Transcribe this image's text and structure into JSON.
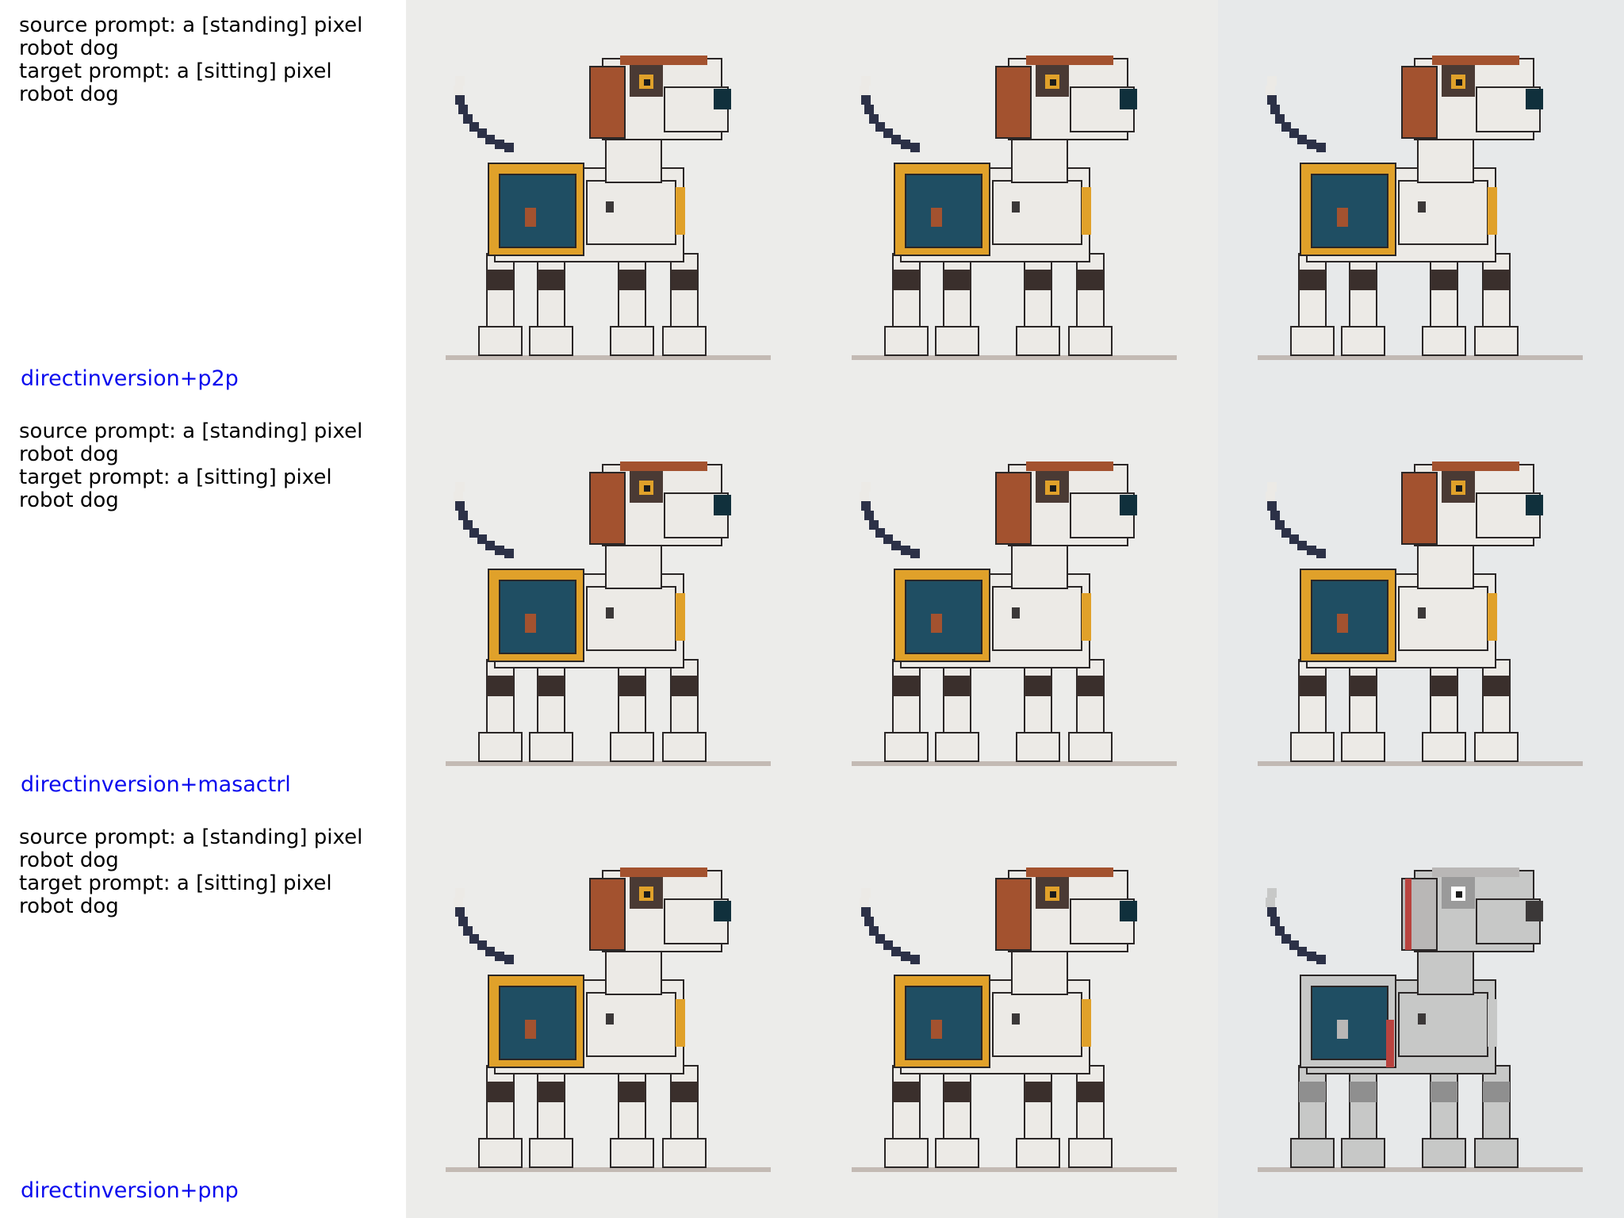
{
  "rows": [
    {
      "source_prompt": "source prompt: a [standing] pixel robot dog",
      "target_prompt": "target prompt: a [sitting] pixel robot dog",
      "method": "directinversion+p2p",
      "images": [
        {
          "subject": "pixel robot dog",
          "variant": "source"
        },
        {
          "subject": "pixel robot dog",
          "variant": "reconstruction"
        },
        {
          "subject": "pixel robot dog",
          "variant": "edited"
        }
      ]
    },
    {
      "source_prompt": "source prompt: a [standing] pixel robot dog",
      "target_prompt": "target prompt: a [sitting] pixel robot dog",
      "method": "directinversion+masactrl",
      "images": [
        {
          "subject": "pixel robot dog",
          "variant": "source"
        },
        {
          "subject": "pixel robot dog",
          "variant": "reconstruction"
        },
        {
          "subject": "pixel robot dog",
          "variant": "edited"
        }
      ]
    },
    {
      "source_prompt": "source prompt: a [standing] pixel robot dog",
      "target_prompt": "target prompt: a [sitting] pixel robot dog",
      "method": "directinversion+pnp",
      "images": [
        {
          "subject": "pixel robot dog",
          "variant": "source"
        },
        {
          "subject": "pixel robot dog",
          "variant": "reconstruction"
        },
        {
          "subject": "pixel robot dog",
          "variant": "edited"
        }
      ]
    }
  ],
  "colors": {
    "link": "#0a0aee",
    "image_background": "#ececea",
    "image_background_grey": "#e7e9ea",
    "dog_white": "#eceae6",
    "dog_grey": "#c7c8c7",
    "dog_teal": "#1f4e63",
    "dog_orange": "#e0a12a",
    "dog_brown": "#a3522f",
    "dog_outline": "#2a2626",
    "dog_tail": "#2c3147"
  }
}
